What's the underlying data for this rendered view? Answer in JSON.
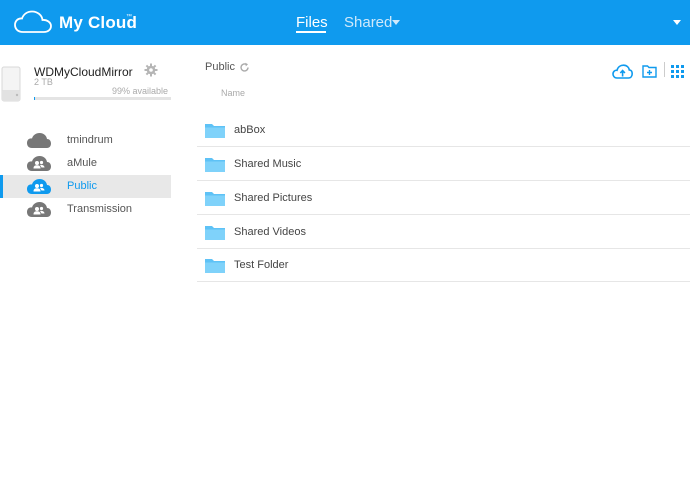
{
  "header": {
    "brand": "My Cloud",
    "brand_tm": "™",
    "nav": {
      "files": "Files",
      "shared": "Shared"
    },
    "accent": "#0f9aee"
  },
  "device": {
    "name": "WDMyCloudMirror",
    "capacity": "2 TB",
    "available": "99% available",
    "used_fraction": 0.01
  },
  "sidebar": {
    "shares": [
      {
        "label": "tmindrum",
        "icon": "cloud-icon",
        "selected": false
      },
      {
        "label": "aMule",
        "icon": "shared-users-icon",
        "selected": false
      },
      {
        "label": "Public",
        "icon": "shared-users-icon",
        "selected": true
      },
      {
        "label": "Transmission",
        "icon": "shared-users-icon",
        "selected": false
      }
    ]
  },
  "main": {
    "breadcrumb": "Public",
    "column_header": "Name",
    "toolbar": [
      "upload-icon",
      "new-folder-icon",
      "grid-view-icon"
    ],
    "files": [
      {
        "name": "abBox",
        "type": "folder"
      },
      {
        "name": "Shared Music",
        "type": "folder"
      },
      {
        "name": "Shared Pictures",
        "type": "folder"
      },
      {
        "name": "Shared Videos",
        "type": "folder"
      },
      {
        "name": "Test Folder",
        "type": "folder"
      }
    ]
  }
}
